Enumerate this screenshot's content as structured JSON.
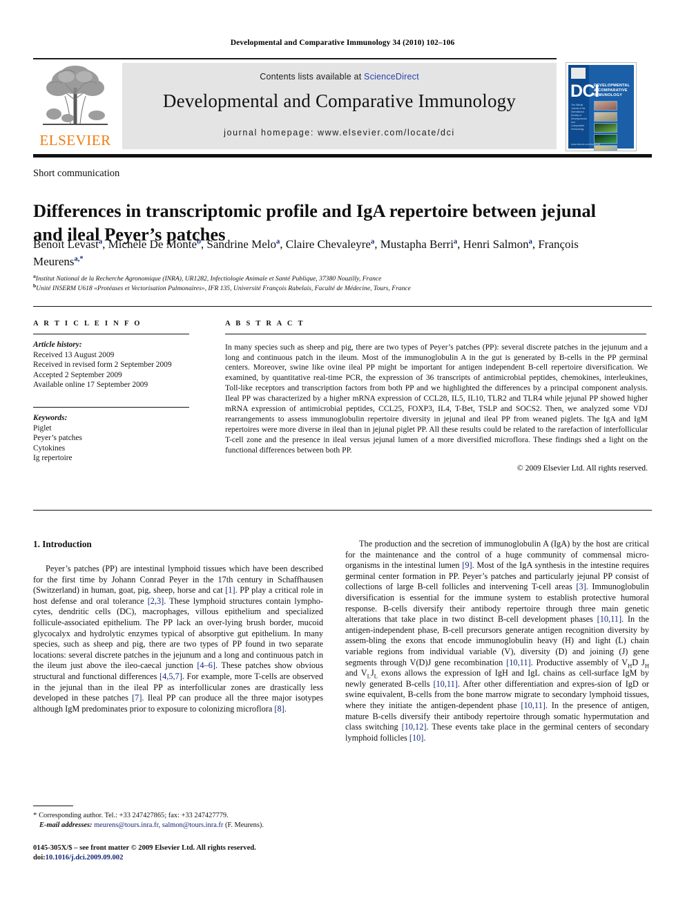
{
  "running_head": "Developmental and Comparative Immunology 34 (2010) 102–106",
  "masthead": {
    "contents_prefix": "Contents lists available at ",
    "sciencedirect": "ScienceDirect",
    "journal_title": "Developmental and Comparative Immunology",
    "homepage": "journal homepage: www.elsevier.com/locate/dci",
    "publisher_logo_text": "ELSEVIER",
    "link_color": "#2b3fb0"
  },
  "cover": {
    "acronym": "DCI",
    "title_lines": "DEVELOPMENTAL & COMPARATIVE IMMUNOLOGY",
    "blurb": "The Official Journal of the International Society of Developmental and Comparative Immunology",
    "footer_url": "www.elsevier.com/locate/dci",
    "background": "#1a5fa8"
  },
  "article": {
    "type": "Short communication",
    "title": "Differences in transcriptomic profile and IgA repertoire between jejunal and ileal Peyer’s patches",
    "authors": [
      {
        "name": "Benoît Levast",
        "sup": "a"
      },
      {
        "name": "Michèle De Monte",
        "sup": "b"
      },
      {
        "name": "Sandrine Melo",
        "sup": "a"
      },
      {
        "name": "Claire Chevaleyre",
        "sup": "a"
      },
      {
        "name": "Mustapha Berri",
        "sup": "a"
      },
      {
        "name": "Henri Salmon",
        "sup": "a"
      },
      {
        "name": "François Meurens",
        "sup": "a,*"
      }
    ],
    "affiliations": [
      {
        "marker": "a",
        "text": "Institut National de la Recherche Agronomique (INRA), UR1282, Infectiologie Animale et Santé Publique, 37380 Nouzilly, France"
      },
      {
        "marker": "b",
        "text": "Unité INSERM U618 «Protéases et Vectorisation Pulmonaires», IFR 135, Université François Rabelais, Faculté de Médecine, Tours, France"
      }
    ]
  },
  "article_info": {
    "heading": "A R T I C L E   I N F O",
    "history_label": "Article history:",
    "history": [
      "Received 13 August 2009",
      "Received in revised form 2 September 2009",
      "Accepted 2 September 2009",
      "Available online 17 September 2009"
    ],
    "keywords_label": "Keywords:",
    "keywords": [
      "Piglet",
      "Peyer’s patches",
      "Cytokines",
      "Ig repertoire"
    ]
  },
  "abstract": {
    "heading": "A B S T R A C T",
    "text": "In many species such as sheep and pig, there are two types of Peyer’s patches (PP): several discrete patches in the jejunum and a long and continuous patch in the ileum. Most of the immunoglobulin A in the gut is generated by B-cells in the PP germinal centers. Moreover, swine like ovine ileal PP might be important for antigen independent B-cell repertoire diversification. We examined, by quantitative real-time PCR, the expression of 36 transcripts of antimicrobial peptides, chemokines, interleukines, Toll-like receptors and transcription factors from both PP and we highlighted the differences by a principal component analysis. Ileal PP was characterized by a higher mRNA expression of CCL28, IL5, IL10, TLR2 and TLR4 while jejunal PP showed higher mRNA expression of antimicrobial peptides, CCL25, FOXP3, IL4, T-Bet, TSLP and SOCS2. Then, we analyzed some VDJ rearrangements to assess immunoglobulin repertoire diversity in jejunal and ileal PP from weaned piglets. The IgA and IgM repertoires were more diverse in ileal than in jejunal piglet PP. All these results could be related to the rarefaction of interfollicular T-cell zone and the presence in ileal versus jejunal lumen of a more diversified microflora. These findings shed a light on the functional differences between both PP.",
    "copyright": "© 2009 Elsevier Ltd. All rights reserved."
  },
  "introduction": {
    "heading": "1. Introduction",
    "left_paragraph_parts": [
      "Peyer’s patches (PP) are intestinal lymphoid tissues which have been described for the first time by Johann Conrad Peyer in the 17th century in Schaffhausen (Switzerland) in human, goat, pig, sheep, horse and cat ",
      "[1]",
      ". PP play a critical role in host defense and oral tolerance ",
      "[2,3]",
      ". These lymphoid structures contain lympho-cytes, dendritic cells (DC), macrophages, villous epithelium and specialized follicule-associated epithelium. The PP lack an over-lying brush border, mucoid glycocalyx and hydrolytic enzymes typical of absorptive gut epithelium. In many species, such as sheep and pig, there are two types of PP found in two separate locations: several discrete patches in the jejunum and a long and continuous patch in the ileum just above the ileo-caecal junction ",
      "[4–6]",
      ". These patches show obvious structural and functional differences ",
      "[4,5,7]",
      ". For example, more T-cells are observed in the jejunal than in the ileal PP as interfollicular zones are drastically less developed in these patches ",
      "[7]",
      ". Ileal PP can produce all the three major isotypes although IgM predominates prior to exposure to colonizing microflora ",
      "[8]",
      "."
    ],
    "right_paragraph_parts": [
      "The production and the secretion of immunoglobulin A (IgA) by the host are critical for the maintenance and the control of a huge community of commensal micro-organisms in the intestinal lumen ",
      "[9]",
      ". Most of the IgA synthesis in the intestine requires germinal center formation in PP. Peyer’s patches and particularly jejunal PP consist of collections of large B-cell follicles and intervening T-cell areas ",
      "[3]",
      ". Immunoglobulin diversification is essential for the immune system to establish protective humoral response. B-cells diversify their antibody repertoire through three main genetic alterations that take place in two distinct B-cell development phases ",
      "[10,11]",
      ". In the antigen-independent phase, B-cell precursors generate antigen recognition diversity by assem-bling the exons that encode immunoglobulin heavy (H) and light (L) chain variable regions from individual variable (V), diversity (D) and joining (J) gene segments through V(D)J gene recombination ",
      "[10,11]",
      ". Productive assembly of V",
      "H",
      "D J",
      "H",
      " and V",
      "L",
      "J",
      "L",
      " exons allows the expression of IgH and IgL chains as cell-surface IgM by newly generated B-cells ",
      "[10,11]",
      ". After other differentiation and expres-sion of IgD or swine equivalent, B-cells from the bone marrow migrate to secondary lymphoid tissues, where they initiate the antigen-dependent phase ",
      "[10,11]",
      ". In the presence of antigen, mature B-cells diversify their antibody repertoire through somatic hypermutation and class switching ",
      "[10,12]",
      ". These events take place in the germinal centers of secondary lymphoid follicles ",
      "[10]",
      "."
    ]
  },
  "footnote": {
    "marker": "*",
    "corresponding": "Corresponding author. Tel.: +33 247427865; fax: +33 247427779.",
    "email_label": "E-mail addresses:",
    "email1": "meurens@tours.inra.fr",
    "email2": "salmon@tours.inra.fr",
    "email_suffix": "(F. Meurens)."
  },
  "imprint": {
    "line1": "0145-305X/$ – see front matter © 2009 Elsevier Ltd. All rights reserved.",
    "doi_prefix": "doi:",
    "doi": "10.1016/j.dci.2009.09.002"
  }
}
